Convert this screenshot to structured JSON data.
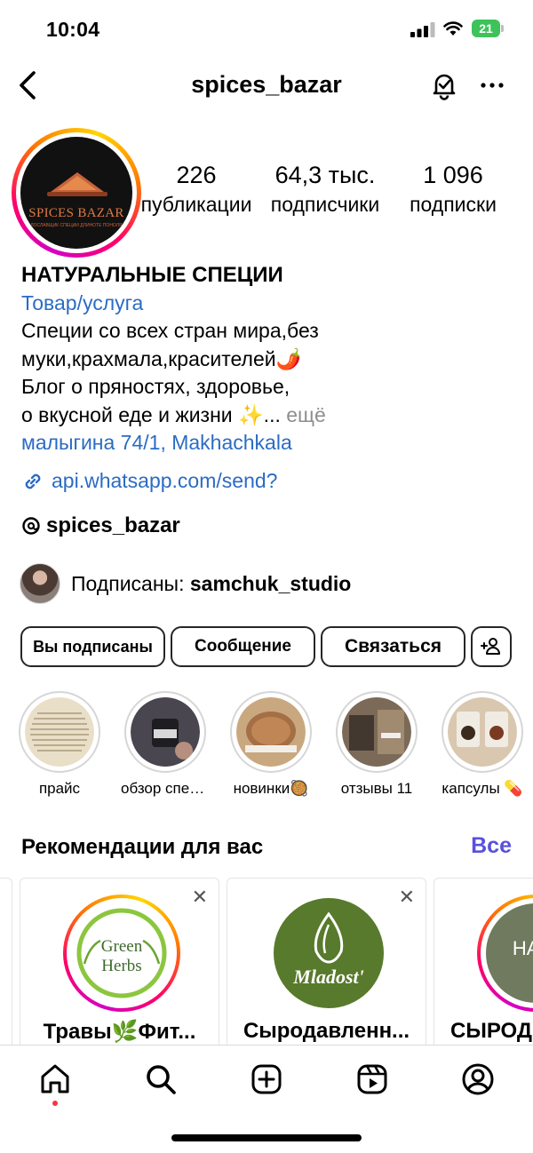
{
  "status_bar": {
    "time": "10:04",
    "battery": "21"
  },
  "header": {
    "title": "spices_bazar"
  },
  "profile": {
    "logo_brand": "SPICES BAZAR",
    "logo_tagline": "ЛОСЛАВЩИК СПЕЦИИ ДЛИНОТЕ ПОНОЛЯ",
    "stats": [
      {
        "value": "226",
        "label": "публикации"
      },
      {
        "value": "64,3 тыс.",
        "label": "подписчики"
      },
      {
        "value": "1 096",
        "label": "подписки"
      }
    ],
    "name": "НАТУРАЛЬНЫЕ СПЕЦИИ",
    "category": "Товар/услуга",
    "bio_lines": [
      "Специи со всех стран мира,без",
      "муки,крахмала,красителей🌶️",
      "Блог о пряностях, здоровье,",
      "о вкусной еде и жизни ✨..."
    ],
    "bio_more": "ещё",
    "location": "малыгина 74/1, Makhachkala",
    "link": "api.whatsapp.com/send?",
    "threads_handle": "spices_bazar",
    "followed_by_prefix": "Подписаны:",
    "followed_by_user": "samchuk_studio"
  },
  "actions": {
    "following": "Вы подписаны",
    "message": "Сообщение",
    "contact": "Связаться"
  },
  "highlights": [
    {
      "label": "прайс",
      "color": "#e8dcc4"
    },
    {
      "label": "обзор спец...",
      "color": "#3c3a40"
    },
    {
      "label": "новинки🥘",
      "color": "#b58a5e"
    },
    {
      "label": "отзывы 11",
      "color": "#6f5f4f"
    },
    {
      "label": "капсулы 💊",
      "color": "#8a6a4a"
    }
  ],
  "recommendations": {
    "title": "Рекомендации для вас",
    "see_all": "Все",
    "close_glyph": "✕",
    "cards": [
      {
        "name": "Травы🌿Фит...",
        "logo_line1": "Green",
        "logo_line2": "Herbs"
      },
      {
        "name": "Сыродавленн...",
        "logo_text": "Mladost'"
      },
      {
        "name": "СЫРОД",
        "logo_text": "HA SI"
      }
    ]
  },
  "tabs": [
    "home-icon",
    "search-icon",
    "create-icon",
    "reels-icon",
    "profile-icon"
  ]
}
